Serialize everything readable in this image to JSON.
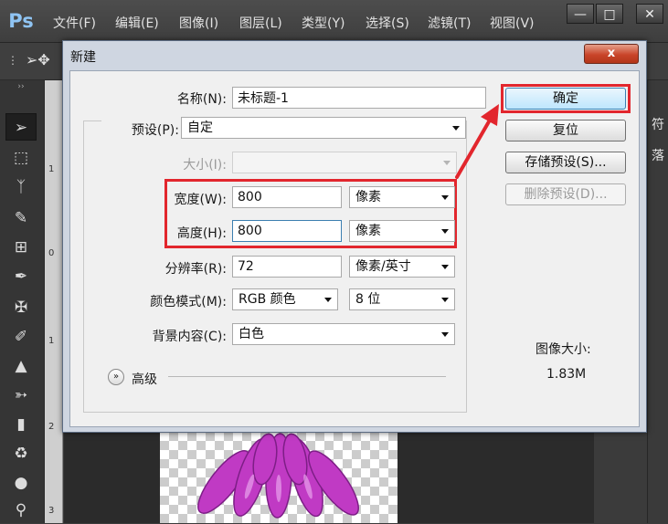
{
  "app": {
    "logo": "Ps",
    "menu": [
      "文件(F)",
      "编辑(E)",
      "图像(I)",
      "图层(L)",
      "类型(Y)",
      "选择(S)",
      "滤镜(T)",
      "视图(V)"
    ],
    "window_buttons": [
      "minimize",
      "maximize",
      "close"
    ],
    "ruler_numbers": [
      "1",
      "0",
      "1",
      "2",
      "3"
    ],
    "right_panel_chars": [
      "符",
      "落"
    ]
  },
  "dialog": {
    "title": "新建",
    "close_symbol": "x",
    "name_label": "名称(N):",
    "name_value": "未标题-1",
    "preset_label": "预设(P):",
    "preset_value": "自定",
    "size_label": "大小(I):",
    "size_value": "",
    "width_label": "宽度(W):",
    "width_value": "800",
    "width_unit": "像素",
    "height_label": "高度(H):",
    "height_value": "800",
    "height_unit": "像素",
    "resolution_label": "分辨率(R):",
    "resolution_value": "72",
    "resolution_unit": "像素/英寸",
    "color_mode_label": "颜色模式(M):",
    "color_mode_value": "RGB 颜色",
    "bit_depth_value": "8 位",
    "background_label": "背景内容(C):",
    "background_value": "白色",
    "advanced_label": "高级",
    "buttons": {
      "ok": "确定",
      "reset": "复位",
      "save_preset": "存储预设(S)...",
      "delete_preset": "删除预设(D)..."
    },
    "image_size_label": "图像大小:",
    "image_size_value": "1.83M"
  },
  "colors": {
    "annotation_red": "#e2262d",
    "flower_magenta": "#c03ac4"
  }
}
